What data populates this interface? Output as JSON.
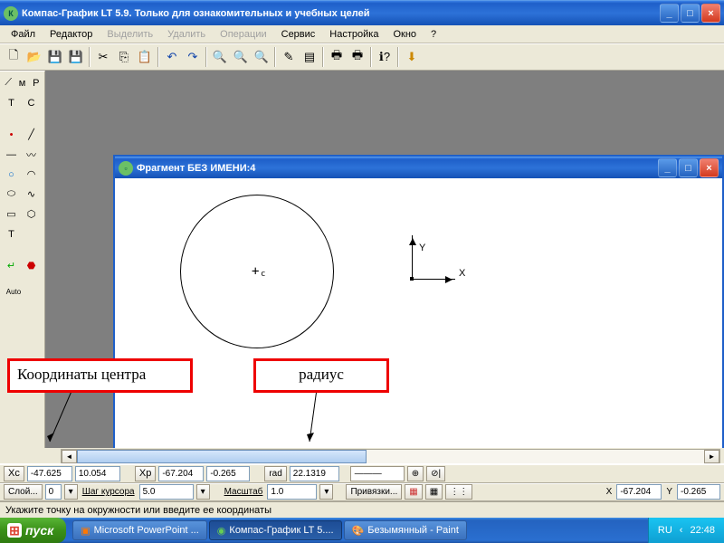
{
  "title": "Компас-График LT 5.9. Только для ознакомительных и учебных целей",
  "menu": {
    "file": "Файл",
    "edit": "Редактор",
    "select": "Выделить",
    "delete": "Удалить",
    "ops": "Операции",
    "service": "Сервис",
    "setup": "Настройка",
    "window": "Окно",
    "help": "?"
  },
  "mdi": {
    "title": "Фрагмент БЕЗ ИМЕНИ:4"
  },
  "axes": {
    "x": "X",
    "y": "Y"
  },
  "annot": {
    "center": "Координаты центра",
    "radius": "радиус"
  },
  "params1": {
    "xc_lbl": "X",
    "xc_sub": "c",
    "xc": "-47.625",
    "yc": "10.054",
    "xp_lbl": "X",
    "xp_sub": "p",
    "xp": "-67.204",
    "yp": "-0.265",
    "rad_lbl": "rad",
    "rad": "22.1319"
  },
  "params2": {
    "layer": "Слой...",
    "layer_v": "0",
    "step_lbl": "Шаг курсора",
    "step_v": "5.0",
    "scale_lbl": "Масштаб",
    "scale_v": "1.0",
    "snap": "Привязки...",
    "x_lbl": "X",
    "x_v": "-67.204",
    "y_lbl": "Y",
    "y_v": "-0.265"
  },
  "status": "Укажите точку на окружности или введите ее координаты",
  "taskbar": {
    "start": "пуск",
    "t1": "Microsoft PowerPoint ...",
    "t2": "Компас-График LT 5....",
    "t3": "Безымянный - Paint",
    "lang": "RU",
    "time": "22:48"
  }
}
